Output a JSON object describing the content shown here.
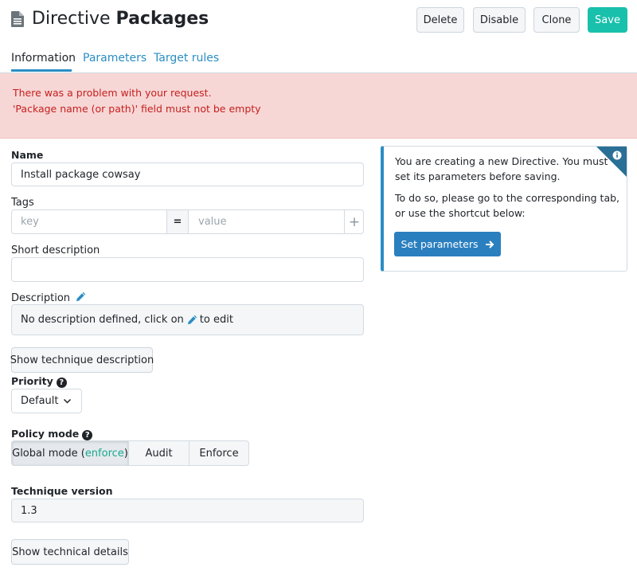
{
  "header": {
    "title_prefix": "Directive",
    "title_bold": "Packages",
    "actions": {
      "delete": "Delete",
      "disable": "Disable",
      "clone": "Clone",
      "save": "Save"
    }
  },
  "tabs": [
    {
      "label": "Information",
      "active": true
    },
    {
      "label": "Parameters",
      "active": false
    },
    {
      "label": "Target rules",
      "active": false
    }
  ],
  "alert": {
    "line1": "There was a problem with your request.",
    "line2": "'Package name (or path)' field must not be empty"
  },
  "form": {
    "name_label": "Name",
    "name_value": "Install package cowsay",
    "tags_label": "Tags",
    "tag_key_placeholder": "key",
    "tag_separator": "=",
    "tag_value_placeholder": "value",
    "tag_add": "+",
    "short_desc_label": "Short description",
    "short_desc_value": "",
    "desc_label": "Description",
    "desc_text_before": "No description defined, click on",
    "desc_text_after": "to edit",
    "show_technique_desc": "Show technique description",
    "priority_label": "Priority",
    "priority_value": "Default",
    "policy_mode_label": "Policy mode",
    "policy_modes": {
      "global_prefix": "Global mode (",
      "global_mode": "enforce",
      "global_suffix": ")",
      "audit": "Audit",
      "enforce": "Enforce"
    },
    "technique_version_label": "Technique version",
    "technique_version_value": "1.3",
    "show_technical_details": "Show technical details"
  },
  "info_panel": {
    "line1": "You are creating a new Directive. You must",
    "line2": "set its parameters before saving.",
    "line3": "To do so, please go to the corresponding tab,",
    "line4": "or use the shortcut below:",
    "button_label": "Set parameters"
  },
  "colors": {
    "accent": "#2a8ec4",
    "save": "#19c0ac",
    "alert_bg": "#f7d7d6",
    "alert_text": "#c5201f",
    "enforce_text": "#19a88f"
  }
}
